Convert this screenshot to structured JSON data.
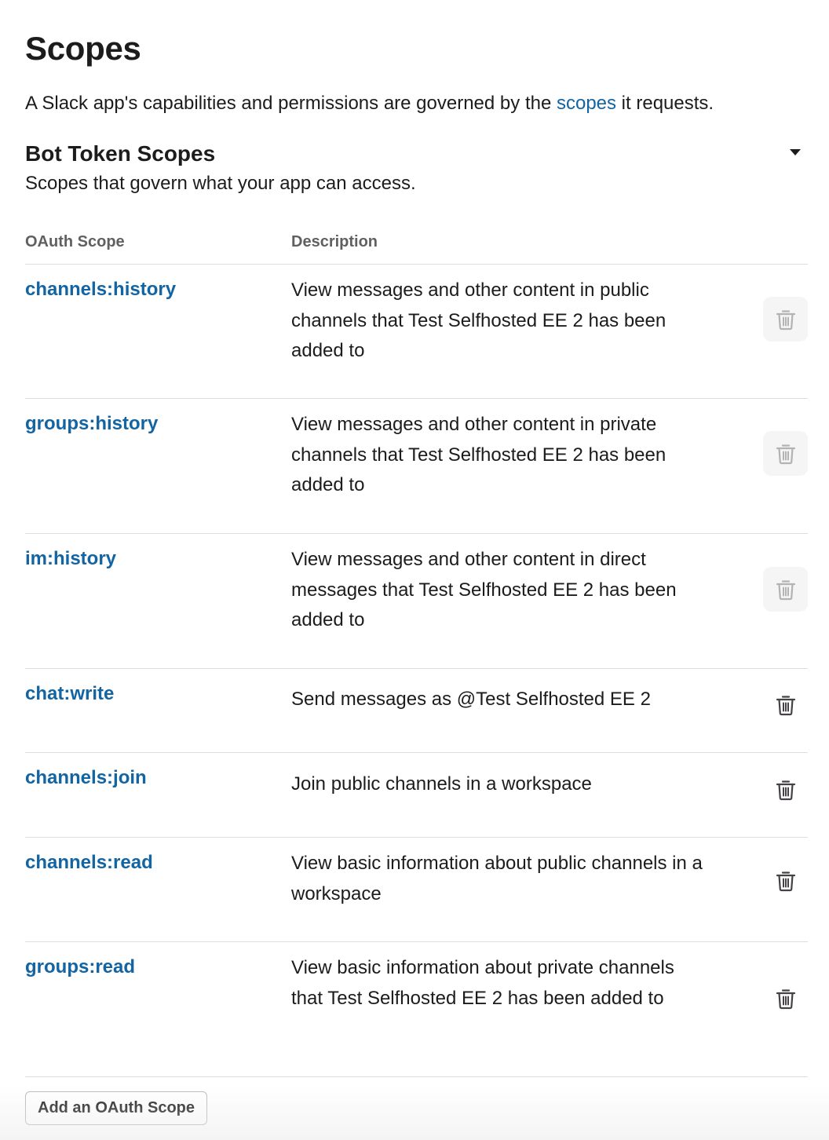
{
  "page": {
    "title": "Scopes",
    "intro_before": "A Slack app's capabilities and permissions are governed by the ",
    "intro_link": "scopes",
    "intro_after": " it requests."
  },
  "section": {
    "title": "Bot Token Scopes",
    "subtitle": "Scopes that govern what your app can access.",
    "toggle_icon": "caret-down-icon"
  },
  "table": {
    "headers": {
      "scope": "OAuth Scope",
      "description": "Description"
    },
    "rows": [
      {
        "scope": "channels:history",
        "description": "View messages and other content in public channels that Test Selfhosted EE 2 has been added to",
        "delete_disabled": true
      },
      {
        "scope": "groups:history",
        "description": "View messages and other content in private channels that Test Selfhosted EE 2 has been added to",
        "delete_disabled": true
      },
      {
        "scope": "im:history",
        "description": "View messages and other content in direct messages that Test Selfhosted EE 2 has been added to",
        "delete_disabled": true
      },
      {
        "scope": "chat:write",
        "description": "Send messages as @Test Selfhosted EE 2",
        "delete_disabled": false
      },
      {
        "scope": "channels:join",
        "description": "Join public channels in a workspace",
        "delete_disabled": false
      },
      {
        "scope": "channels:read",
        "description": "View basic information about public channels in a workspace",
        "delete_disabled": false
      },
      {
        "scope": "groups:read",
        "description": "View basic information about private channels that Test Selfhosted EE 2 has been added to",
        "delete_disabled": false
      }
    ],
    "delete_icon": "trash-icon"
  },
  "actions": {
    "add_scope_label": "Add an OAuth Scope"
  },
  "colors": {
    "link": "#1264a3",
    "text": "#1d1c1d",
    "muted": "#616061",
    "icon_enabled": "#454245",
    "icon_disabled": "#b3b3b3",
    "disabled_bg": "#f5f5f5",
    "divider": "#dddddd"
  }
}
